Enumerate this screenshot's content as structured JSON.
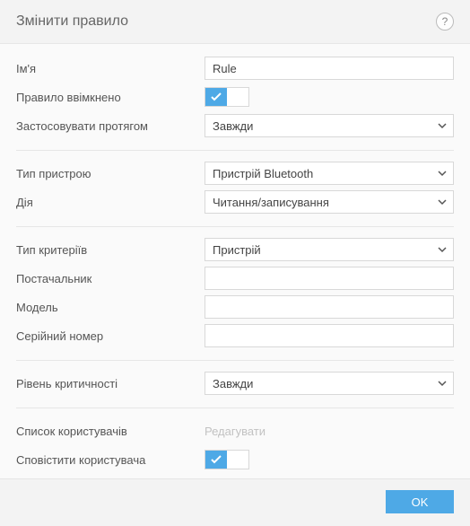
{
  "header": {
    "title": "Змінити правило"
  },
  "fields": {
    "name_label": "Ім'я",
    "name_value": "Rule",
    "enabled_label": "Правило ввімкнено",
    "apply_during_label": "Застосовувати протягом",
    "apply_during_value": "Завжди",
    "device_type_label": "Тип пристрою",
    "device_type_value": "Пристрій Bluetooth",
    "action_label": "Дія",
    "action_value": "Читання/записування",
    "criteria_type_label": "Тип критеріїв",
    "criteria_type_value": "Пристрій",
    "vendor_label": "Постачальник",
    "vendor_value": "",
    "model_label": "Модель",
    "model_value": "",
    "serial_label": "Серійний номер",
    "serial_value": "",
    "severity_label": "Рівень критичності",
    "severity_value": "Завжди",
    "user_list_label": "Список користувачів",
    "user_list_action": "Редагувати",
    "notify_label": "Сповістити користувача"
  },
  "footer": {
    "ok": "OK"
  }
}
